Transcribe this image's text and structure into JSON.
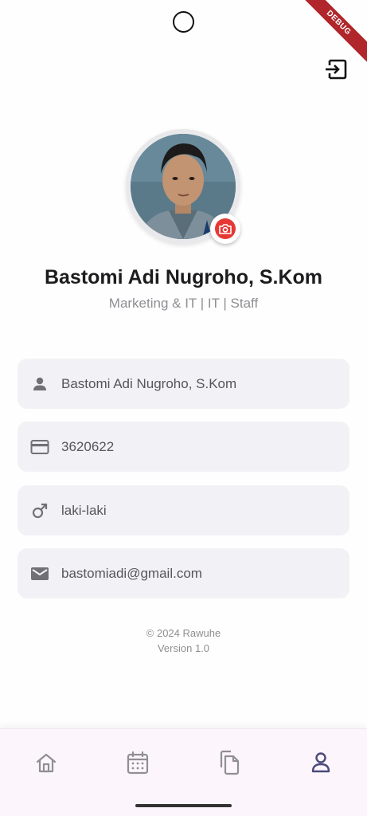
{
  "app": {
    "debug_banner": "DEBUG"
  },
  "profile": {
    "name": "Bastomi Adi Nugroho, S.Kom",
    "role": "Marketing & IT | IT | Staff"
  },
  "fields": [
    {
      "icon": "person-icon",
      "value": "Bastomi Adi Nugroho, S.Kom"
    },
    {
      "icon": "credit-card-icon",
      "value": "3620622"
    },
    {
      "icon": "male-icon",
      "value": "laki-laki"
    },
    {
      "icon": "mail-icon",
      "value": "bastomiadi@gmail.com"
    }
  ],
  "footer": {
    "copyright": "© 2024 Rawuhe",
    "version": "Version 1.0"
  },
  "nav": {
    "items": [
      {
        "icon": "home-icon",
        "active": false
      },
      {
        "icon": "calendar-icon",
        "active": false
      },
      {
        "icon": "documents-icon",
        "active": false
      },
      {
        "icon": "profile-icon",
        "active": true
      }
    ]
  },
  "colors": {
    "accent": "#e53935",
    "nav_active": "#4b4a7a",
    "nav_inactive": "#8f8f94",
    "debug_ribbon": "#b0262a"
  }
}
